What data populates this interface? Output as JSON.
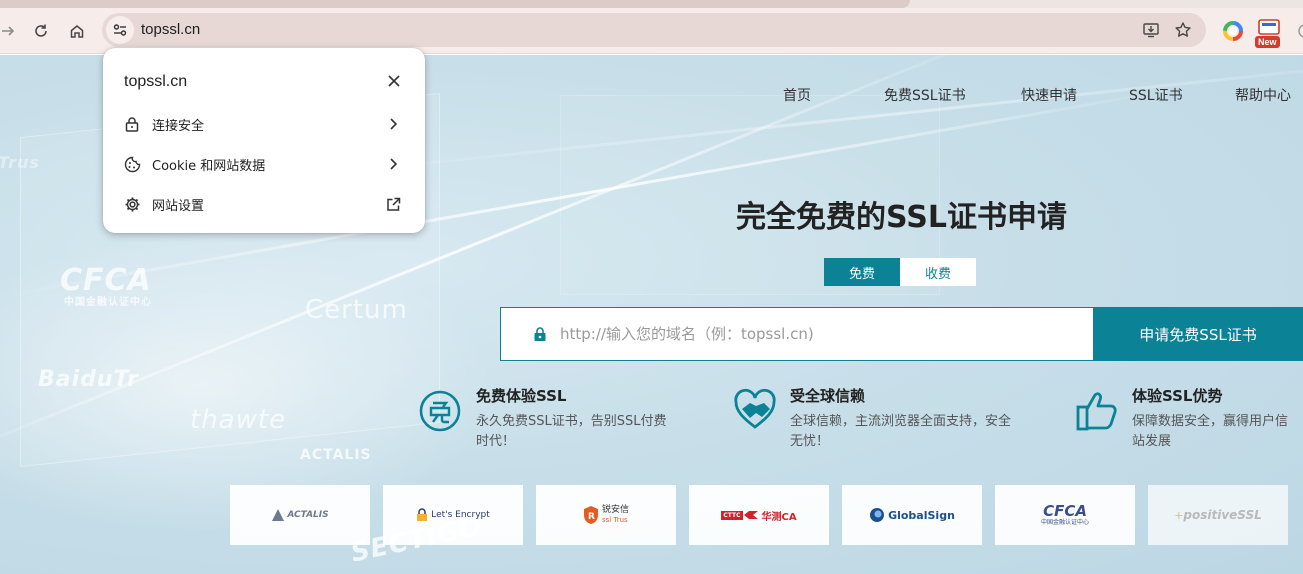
{
  "browser": {
    "url": "topssl.cn",
    "new_badge": "New"
  },
  "site_popup": {
    "title": "topssl.cn",
    "items": [
      {
        "label": "连接安全",
        "icon": "lock-icon",
        "trail": "chevron-right-icon"
      },
      {
        "label": "Cookie 和网站数据",
        "icon": "cookie-icon",
        "trail": "chevron-right-icon"
      },
      {
        "label": "网站设置",
        "icon": "gear-icon",
        "trail": "external-link-icon"
      }
    ]
  },
  "nav": {
    "items": [
      "首页",
      "免费SSL证书",
      "快速申请",
      "SSL证书",
      "帮助中心"
    ]
  },
  "hero": {
    "title": "完全免费的SSL证书申请",
    "tabs": [
      {
        "label": "免费",
        "active": true
      },
      {
        "label": "收费",
        "active": false
      }
    ],
    "search": {
      "placeholder": "http://输入您的域名（例：topssl.cn)",
      "button": "申请免费SSL证书"
    }
  },
  "features": [
    {
      "title": "免费体验SSL",
      "desc_line1": "永久免费SSL证书，告别SSL付费",
      "desc_line2": "时代！",
      "icon": "free-badge-icon"
    },
    {
      "title": "受全球信赖",
      "desc_line1": "全球信赖，主流浏览器全面支持，安全",
      "desc_line2": "无忧！",
      "icon": "handshake-heart-icon"
    },
    {
      "title": "体验SSL优势",
      "desc_line1": "保障数据安全，赢得用户信",
      "desc_line2": "站发展",
      "icon": "thumbs-up-icon"
    }
  ],
  "ca_logos": [
    {
      "name": "ACTALIS"
    },
    {
      "name": "Let's Encrypt"
    },
    {
      "name_cn": "锐安信",
      "name_en": "ssl Trus"
    },
    {
      "name_cn": "华测CA",
      "prefix": "CTTC"
    },
    {
      "name": "GlobalSign"
    },
    {
      "name": "CFCA",
      "sub": "中国金融认证中心"
    },
    {
      "name": "positiveSSL"
    }
  ],
  "background_logos": [
    "CFCA",
    "中国金融认证中心",
    "Certum",
    "BaiduTr",
    "thawte",
    "ACTALIS",
    "SECTIGO",
    "Trus"
  ],
  "colors": {
    "accent": "#0b8295",
    "page_bg": "#c8dfe9",
    "chrome_bg": "#f6ecea"
  }
}
